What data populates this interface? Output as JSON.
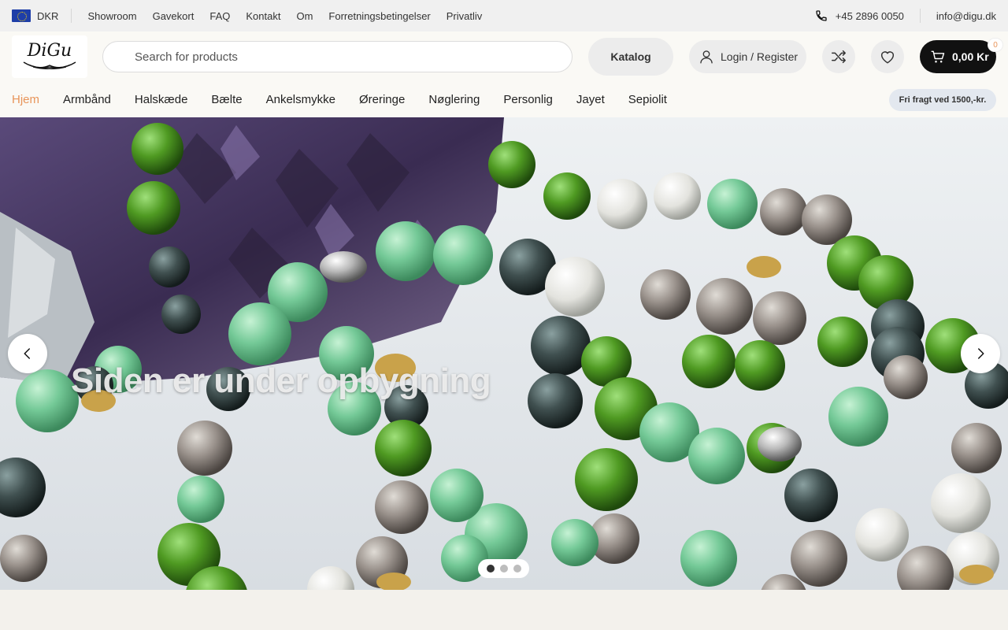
{
  "topbar": {
    "currency": "DKR",
    "links": [
      "Showroom",
      "Gavekort",
      "FAQ",
      "Kontakt",
      "Om",
      "Forretningsbetingelser",
      "Privatliv"
    ],
    "phone": "+45 2896 0050",
    "email": "info@digu.dk"
  },
  "header": {
    "logo_text": "DiGu",
    "search_placeholder": "Search for products",
    "catalog_label": "Katalog",
    "login_label": "Login / Register",
    "cart_total": "0,00 Kr",
    "cart_count": "0"
  },
  "nav": {
    "items": [
      "Hjem",
      "Armbånd",
      "Halskæde",
      "Bælte",
      "Ankelsmykke",
      "Øreringe",
      "Nøglering",
      "Personlig",
      "Jayet",
      "Sepiolit"
    ],
    "active_index": 0,
    "promo": "Fri fragt ved 1500,-kr."
  },
  "hero": {
    "title": "Siden er under opbygning",
    "slides": 3,
    "current_slide": 1
  },
  "colors": {
    "accent": "#e8955a",
    "cart_bg": "#111111",
    "topbar_bg": "#f0f0f0"
  }
}
